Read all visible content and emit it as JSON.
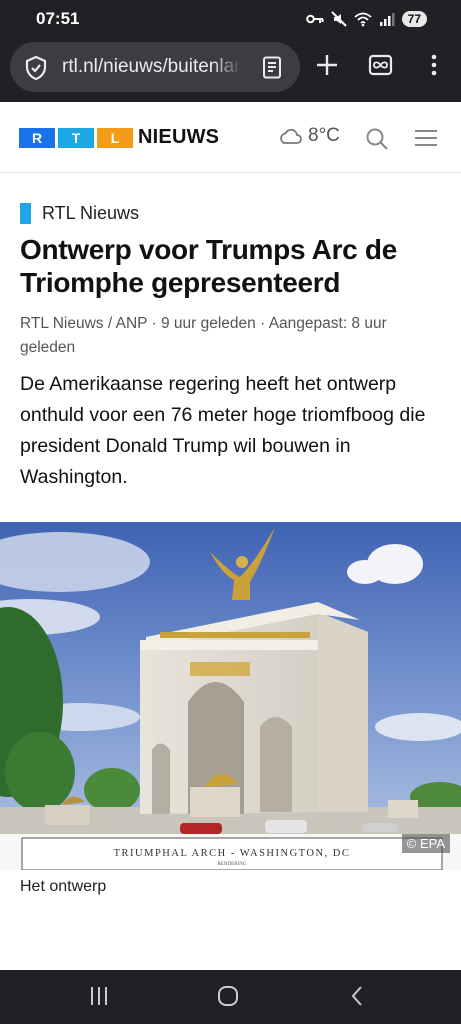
{
  "status": {
    "time": "07:51",
    "battery": "77"
  },
  "browser": {
    "url": "rtl.nl/nieuws/buitenland"
  },
  "site": {
    "logo_letters": [
      "R",
      "T",
      "L"
    ],
    "logo_colors": [
      "#1a73e8",
      "#1ea7e6",
      "#f49b17"
    ],
    "name": "NIEUWS",
    "temperature": "8°C"
  },
  "article": {
    "label": "RTL Nieuws",
    "title": "Ontwerp voor Trumps Arc de Triomphe gepresenteerd",
    "meta": "RTL Nieuws / ANP · 9 uur geleden · Aangepast: 8 uur geleden",
    "intro": "De Amerikaanse regering heeft het ontwerp onthuld voor een 76 meter hoge triomfboog die president Donald Trump wil bouwen in Washington.",
    "image_sign": "TRIUMPHAL ARCH - WASHINGTON, DC",
    "image_sign_sub": "RENDERING",
    "image_credit": "© EPA",
    "caption": "Het ontwerp"
  }
}
